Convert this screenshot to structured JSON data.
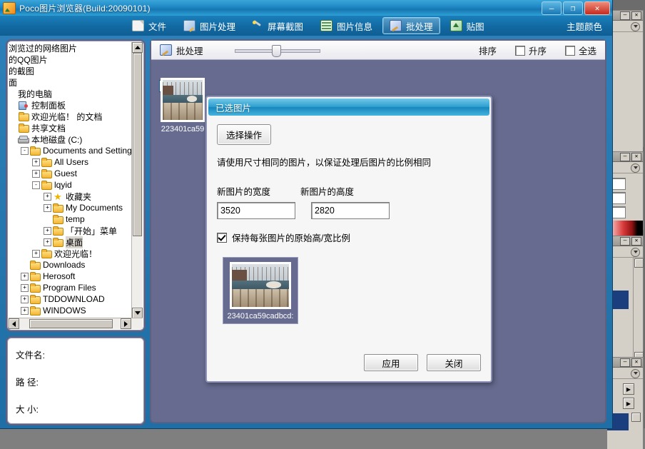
{
  "window": {
    "title": "Poco图片浏览器(Build:20090101)",
    "controls": {
      "minimize": "–",
      "maximize": "❐",
      "close": "✕"
    }
  },
  "menubar": {
    "items": [
      {
        "label": "文件",
        "icon": "file-icon",
        "active": false
      },
      {
        "label": "图片处理",
        "icon": "image-edit-icon",
        "active": false
      },
      {
        "label": "屏幕截图",
        "icon": "screenshot-icon",
        "active": false
      },
      {
        "label": "图片信息",
        "icon": "image-info-icon",
        "active": false
      },
      {
        "label": "批处理",
        "icon": "batch-icon",
        "active": true
      },
      {
        "label": "贴图",
        "icon": "sticker-icon",
        "active": false
      }
    ],
    "theme_link": "主题颜色"
  },
  "tree": {
    "nodes": [
      {
        "label": "浏览过的网络图片",
        "indent": 0,
        "icon": "none",
        "expander": "",
        "clipped": true
      },
      {
        "label": "的QQ图片",
        "indent": 0,
        "icon": "none",
        "expander": "",
        "clipped": true
      },
      {
        "label": "的截图",
        "indent": 0,
        "icon": "none",
        "expander": "",
        "clipped": true
      },
      {
        "label": "面",
        "indent": 0,
        "icon": "none",
        "expander": "",
        "clipped": true
      },
      {
        "label": "我的电脑",
        "indent": 0,
        "icon": "none",
        "expander": ""
      },
      {
        "label": "控制面板",
        "indent": 0,
        "icon": "control-panel-icon",
        "expander": ""
      },
      {
        "label": "欢迎光临！ 的文档",
        "indent": 0,
        "icon": "folder-icon",
        "expander": ""
      },
      {
        "label": "共享文档",
        "indent": 0,
        "icon": "folder-icon",
        "expander": ""
      },
      {
        "label": "本地磁盘 (C:)",
        "indent": 0,
        "icon": "disk-icon",
        "expander": ""
      },
      {
        "label": "Documents and Settings",
        "indent": 1,
        "icon": "folder-icon",
        "expander": "-"
      },
      {
        "label": "All Users",
        "indent": 2,
        "icon": "folder-icon",
        "expander": "+"
      },
      {
        "label": "Guest",
        "indent": 2,
        "icon": "folder-icon",
        "expander": "+"
      },
      {
        "label": "lqyid",
        "indent": 2,
        "icon": "folder-icon",
        "expander": "-"
      },
      {
        "label": "收藏夹",
        "indent": 3,
        "icon": "star-icon",
        "expander": "+"
      },
      {
        "label": "My Documents",
        "indent": 3,
        "icon": "folder-icon",
        "expander": "+"
      },
      {
        "label": "temp",
        "indent": 3,
        "icon": "folder-icon",
        "expander": ""
      },
      {
        "label": "「开始」菜单",
        "indent": 3,
        "icon": "folder-icon",
        "expander": "+"
      },
      {
        "label": "桌面",
        "indent": 3,
        "icon": "folder-icon",
        "expander": "+",
        "selected": true
      },
      {
        "label": "欢迎光临！",
        "indent": 2,
        "icon": "folder-icon",
        "expander": "+"
      },
      {
        "label": "Downloads",
        "indent": 1,
        "icon": "folder-icon",
        "expander": ""
      },
      {
        "label": "Herosoft",
        "indent": 1,
        "icon": "folder-icon",
        "expander": "+"
      },
      {
        "label": "Program Files",
        "indent": 1,
        "icon": "folder-icon",
        "expander": "+"
      },
      {
        "label": "TDDOWNLOAD",
        "indent": 1,
        "icon": "folder-icon",
        "expander": "+"
      },
      {
        "label": "WINDOWS",
        "indent": 1,
        "icon": "folder-icon",
        "expander": "+"
      }
    ]
  },
  "info_panel": {
    "filename_label": "文件名:",
    "path_label": "路  径:",
    "size_label": "大  小:",
    "filename_value": "",
    "path_value": "",
    "size_value": ""
  },
  "main_panel": {
    "title": "批处理",
    "sort_label": "排序",
    "ascending_label": "升序",
    "select_all_label": "全选",
    "ascending_checked": false,
    "select_all_checked": false,
    "zoom_slider_value": 50,
    "thumbnails": [
      {
        "caption": "223401ca59",
        "checked": true
      }
    ]
  },
  "dialog": {
    "header": "已选图片",
    "choose_operation_button": "选择操作",
    "hint": "请使用尺寸相同的图片，以保证处理后图片的比例相同",
    "width_label": "新图片的宽度",
    "height_label": "新图片的高度",
    "width_value": "3520",
    "height_value": "2820",
    "keep_ratio_label": "保持每张图片的原始高/宽比例",
    "keep_ratio_checked": true,
    "thumbnail_caption": "23401ca59cadbcd:",
    "apply_button": "应用",
    "close_button": "关闭"
  },
  "background_app": {
    "panels": [
      {
        "name": "navigator-panel",
        "minimize": "–",
        "close": "✕"
      },
      {
        "name": "color-panel",
        "minimize": "–",
        "close": "✕"
      },
      {
        "name": "layers-panel",
        "minimize": "–",
        "close": "✕"
      },
      {
        "name": "opacity-panel",
        "minimize": "–",
        "close": "✕"
      }
    ]
  },
  "colors": {
    "title_blue": "#1f87c4",
    "menu_blue": "#1269a2",
    "panel_slate": "#666b8f",
    "dialog_header": "#2f9fd0",
    "close_red": "#c32b1d"
  }
}
